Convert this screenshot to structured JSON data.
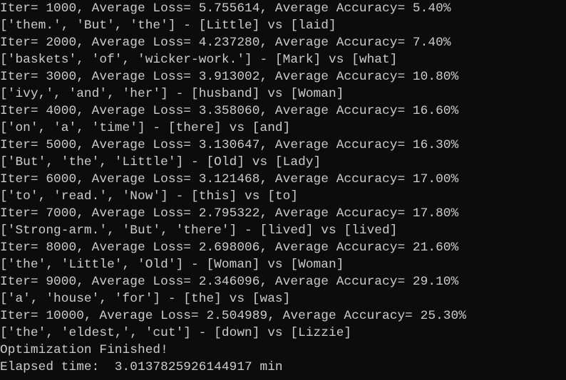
{
  "console": {
    "lines": [
      "Iter= 1000, Average Loss= 5.755614, Average Accuracy= 5.40%",
      "['them.', 'But', 'the'] - [Little] vs [laid]",
      "Iter= 2000, Average Loss= 4.237280, Average Accuracy= 7.40%",
      "['baskets', 'of', 'wicker-work.'] - [Mark] vs [what]",
      "Iter= 3000, Average Loss= 3.913002, Average Accuracy= 10.80%",
      "['ivy,', 'and', 'her'] - [husband] vs [Woman]",
      "Iter= 4000, Average Loss= 3.358060, Average Accuracy= 16.60%",
      "['on', 'a', 'time'] - [there] vs [and]",
      "Iter= 5000, Average Loss= 3.130647, Average Accuracy= 16.30%",
      "['But', 'the', 'Little'] - [Old] vs [Lady]",
      "Iter= 6000, Average Loss= 3.121468, Average Accuracy= 17.00%",
      "['to', 'read.', 'Now'] - [this] vs [to]",
      "Iter= 7000, Average Loss= 2.795322, Average Accuracy= 17.80%",
      "['Strong-arm.', 'But', 'there'] - [lived] vs [lived]",
      "Iter= 8000, Average Loss= 2.698006, Average Accuracy= 21.60%",
      "['the', 'Little', 'Old'] - [Woman] vs [Woman]",
      "Iter= 9000, Average Loss= 2.346096, Average Accuracy= 29.10%",
      "['a', 'house', 'for'] - [the] vs [was]",
      "Iter= 10000, Average Loss= 2.504989, Average Accuracy= 25.30%",
      "['the', 'eldest,', 'cut'] - [down] vs [Lizzie]",
      "Optimization Finished!",
      "Elapsed time:  3.0137825926144917 min"
    ]
  }
}
